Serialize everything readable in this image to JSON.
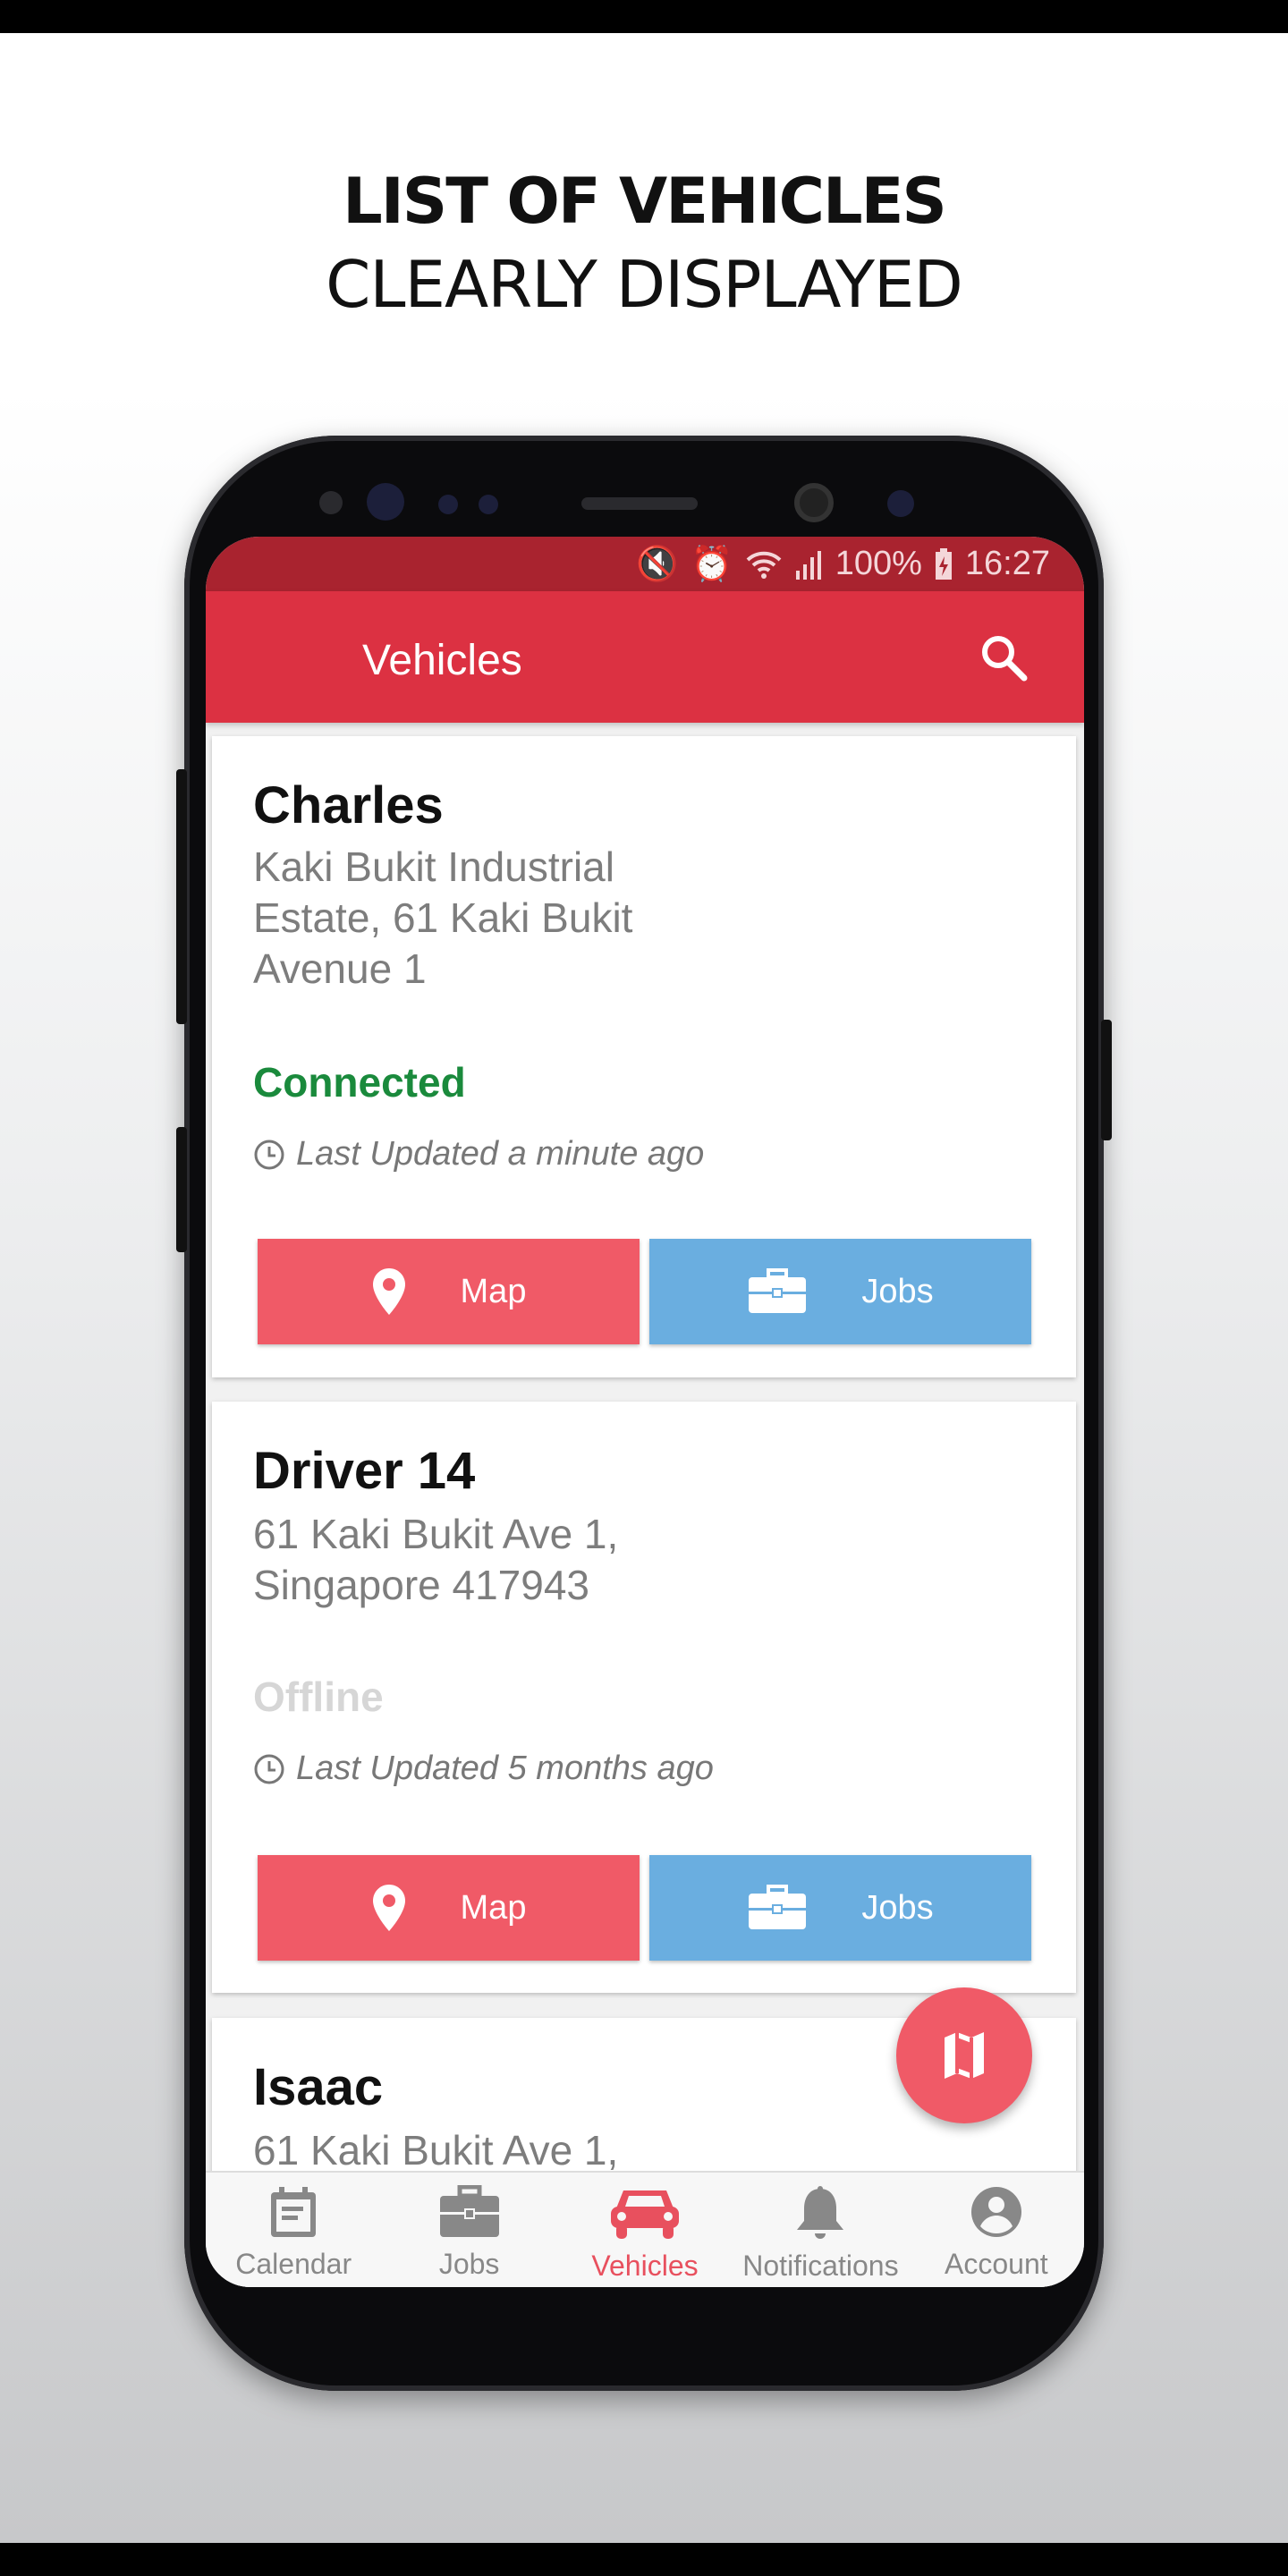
{
  "headline": {
    "line1": "LIST OF VEHICLES",
    "line2": "CLEARLY DISPLAYED"
  },
  "status_bar": {
    "battery": "100%",
    "time": "16:27",
    "icons": [
      "mute-vibrate-icon",
      "alarm-icon",
      "wifi-icon",
      "signal-icon",
      "battery-charging-icon"
    ]
  },
  "app_bar": {
    "title": "Vehicles",
    "action_icon": "search-icon"
  },
  "colors": {
    "status_bar": "#a9232f",
    "app_bar": "#dc3142",
    "map_button": "#f05a67",
    "jobs_button": "#6aaee0",
    "connected": "#1a8a3c",
    "offline": "#d6d6d6",
    "active_nav": "#e8505e"
  },
  "vehicles": [
    {
      "name": "Charles",
      "address": [
        "Kaki Bukit Industrial",
        "Estate, 61 Kaki Bukit",
        "Avenue 1"
      ],
      "status": "Connected",
      "last_updated": "Last Updated a minute ago",
      "map_label": "Map",
      "jobs_label": "Jobs"
    },
    {
      "name": "Driver 14",
      "address": [
        "61 Kaki Bukit Ave 1,",
        "Singapore 417943"
      ],
      "status": "Offline",
      "last_updated": "Last Updated 5 months ago",
      "map_label": "Map",
      "jobs_label": "Jobs"
    },
    {
      "name": "Isaac",
      "address": [
        "61 Kaki Bukit Ave 1,"
      ]
    }
  ],
  "fab": {
    "icon": "map-icon"
  },
  "bottom_nav": [
    {
      "label": "Calendar",
      "icon": "calendar-icon"
    },
    {
      "label": "Jobs",
      "icon": "briefcase-icon"
    },
    {
      "label": "Vehicles",
      "icon": "car-icon",
      "active": true
    },
    {
      "label": "Notifications",
      "icon": "bell-icon"
    },
    {
      "label": "Account",
      "icon": "account-icon"
    }
  ]
}
